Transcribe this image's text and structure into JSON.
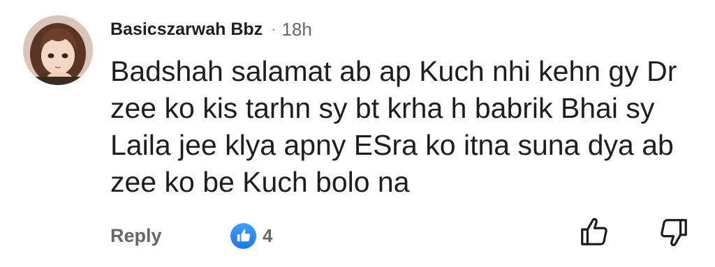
{
  "comment": {
    "author": "Basicszarwah Bbz",
    "separator": "·",
    "time": "18h",
    "text_lines": [
      "Badshah salamat ab ap Kuch nhi kehn gy Dr",
      "zee ko kis tarhn sy bt krha h babrik Bhai sy",
      "Laila jee klya apny ESra ko itna suna dya ab",
      "zee ko be Kuch bolo na"
    ]
  },
  "actions": {
    "reply_label": "Reply",
    "reaction_icon": "like-icon",
    "reaction_count": "4",
    "upvote_icon": "thumbs-up-icon",
    "downvote_icon": "thumbs-down-icon"
  },
  "colors": {
    "text": "#1c1e21",
    "secondary": "#65676b",
    "like_blue": "#1877f2"
  }
}
